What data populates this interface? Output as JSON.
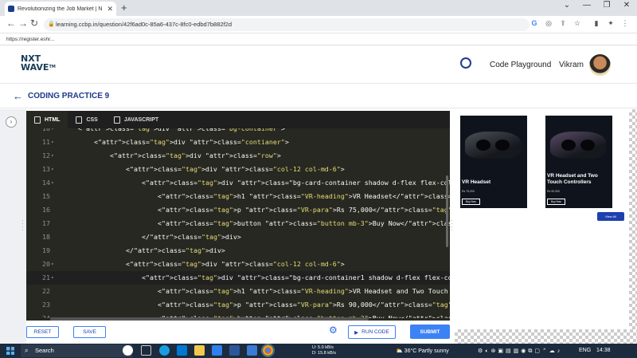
{
  "browser": {
    "tab_title": "Revolutionizing the Job Market | N",
    "url": "learning.ccbp.in/question/42f6ad0c-85a6-437c-8fc0-edbd7b882f2d",
    "bookmark": "https://register.eshr..."
  },
  "header": {
    "logo_line1": "NXT",
    "logo_line2": "WAVE",
    "logo_tm": "TM",
    "code_playground": "Code Playground",
    "user_name": "Vikram"
  },
  "page": {
    "title": "CODING PRACTICE 9"
  },
  "editor": {
    "tabs": [
      {
        "label": "HTML"
      },
      {
        "label": "CSS"
      },
      {
        "label": "JAVASCRIPT"
      }
    ],
    "active_tab": "HTML",
    "lines": [
      {
        "n": "10",
        "fold": "▾",
        "indent": 2,
        "text": "<div class=\"bg-container\">"
      },
      {
        "n": "11",
        "fold": "▾",
        "indent": 4,
        "text": "<div class=\"contianer\">"
      },
      {
        "n": "12",
        "fold": "▾",
        "indent": 6,
        "text": "<div class=\"row\">"
      },
      {
        "n": "13",
        "fold": "▾",
        "indent": 8,
        "text": "<div class=\"col-12 col-md-6\">"
      },
      {
        "n": "14",
        "fold": "▾",
        "indent": 10,
        "text": "<div class=\"bg-card-container shadow d-flex flex-column justify-content-en"
      },
      {
        "n": "15",
        "fold": "",
        "indent": 12,
        "text": "<h1 class=\"VR-heading\">VR Headset</h1>"
      },
      {
        "n": "16",
        "fold": "",
        "indent": 12,
        "text": "<p class=\"VR-para\">Rs 75,000</p>"
      },
      {
        "n": "17",
        "fold": "",
        "indent": 12,
        "text": "<button class=\"button mb-3\">Buy Now</button>"
      },
      {
        "n": "18",
        "fold": "",
        "indent": 10,
        "text": "</div>"
      },
      {
        "n": "19",
        "fold": "",
        "indent": 8,
        "text": "</div>"
      },
      {
        "n": "20",
        "fold": "▾",
        "indent": 8,
        "text": "<div class=\"col-12 col-md-6\">"
      },
      {
        "n": "21",
        "fold": "▾",
        "indent": 10,
        "text": "<div class=\"bg-card-container1 shadow d-flex flex-column justify-content-e"
      },
      {
        "n": "22",
        "fold": "",
        "indent": 12,
        "text": "<h1 class=\"VR-heading\">VR Headset and Two Touch Controllers</h1>"
      },
      {
        "n": "23",
        "fold": "",
        "indent": 12,
        "text": "<p class=\"VR-para\">Rs 90,000</p>"
      },
      {
        "n": "24",
        "fold": "",
        "indent": 12,
        "text": "<button class=\"button mb-3\">Buy Now</button>"
      }
    ],
    "current_line": "21"
  },
  "buttons": {
    "reset": "RESET",
    "save": "SAVE",
    "run_code": "RUN CODE",
    "submit": "SUBMIT"
  },
  "preview": {
    "cards": [
      {
        "heading": "VR Headset",
        "price": "Rs 75,000",
        "button": "Buy Now"
      },
      {
        "heading": "VR Headset and Two Touch Controllers",
        "price": "Rs 90,000",
        "button": "Buy Now"
      }
    ],
    "view_all": "View All"
  },
  "taskbar": {
    "search": "Search",
    "net_up": "U: 5.0 kB/s",
    "net_down": "D: 15.8 kB/s",
    "weather": "36°C  Partly sunny",
    "language": "ENG",
    "time": "14:38"
  }
}
